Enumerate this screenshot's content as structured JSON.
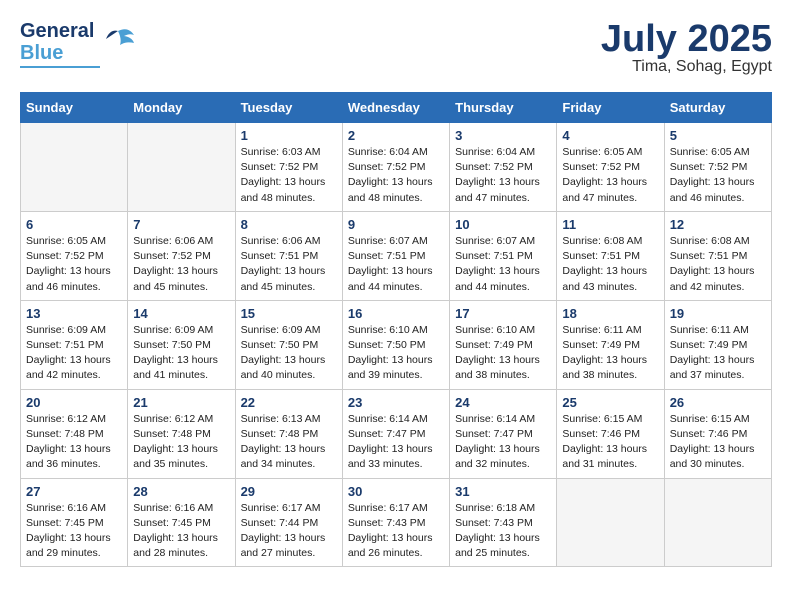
{
  "header": {
    "logo": {
      "line1": "General",
      "line2": "Blue"
    },
    "month": "July 2025",
    "location": "Tima, Sohag, Egypt"
  },
  "days_of_week": [
    "Sunday",
    "Monday",
    "Tuesday",
    "Wednesday",
    "Thursday",
    "Friday",
    "Saturday"
  ],
  "weeks": [
    [
      {
        "day": "",
        "empty": true
      },
      {
        "day": "",
        "empty": true
      },
      {
        "day": "1",
        "sunrise": "Sunrise: 6:03 AM",
        "sunset": "Sunset: 7:52 PM",
        "daylight": "Daylight: 13 hours and 48 minutes."
      },
      {
        "day": "2",
        "sunrise": "Sunrise: 6:04 AM",
        "sunset": "Sunset: 7:52 PM",
        "daylight": "Daylight: 13 hours and 48 minutes."
      },
      {
        "day": "3",
        "sunrise": "Sunrise: 6:04 AM",
        "sunset": "Sunset: 7:52 PM",
        "daylight": "Daylight: 13 hours and 47 minutes."
      },
      {
        "day": "4",
        "sunrise": "Sunrise: 6:05 AM",
        "sunset": "Sunset: 7:52 PM",
        "daylight": "Daylight: 13 hours and 47 minutes."
      },
      {
        "day": "5",
        "sunrise": "Sunrise: 6:05 AM",
        "sunset": "Sunset: 7:52 PM",
        "daylight": "Daylight: 13 hours and 46 minutes."
      }
    ],
    [
      {
        "day": "6",
        "sunrise": "Sunrise: 6:05 AM",
        "sunset": "Sunset: 7:52 PM",
        "daylight": "Daylight: 13 hours and 46 minutes."
      },
      {
        "day": "7",
        "sunrise": "Sunrise: 6:06 AM",
        "sunset": "Sunset: 7:52 PM",
        "daylight": "Daylight: 13 hours and 45 minutes."
      },
      {
        "day": "8",
        "sunrise": "Sunrise: 6:06 AM",
        "sunset": "Sunset: 7:51 PM",
        "daylight": "Daylight: 13 hours and 45 minutes."
      },
      {
        "day": "9",
        "sunrise": "Sunrise: 6:07 AM",
        "sunset": "Sunset: 7:51 PM",
        "daylight": "Daylight: 13 hours and 44 minutes."
      },
      {
        "day": "10",
        "sunrise": "Sunrise: 6:07 AM",
        "sunset": "Sunset: 7:51 PM",
        "daylight": "Daylight: 13 hours and 44 minutes."
      },
      {
        "day": "11",
        "sunrise": "Sunrise: 6:08 AM",
        "sunset": "Sunset: 7:51 PM",
        "daylight": "Daylight: 13 hours and 43 minutes."
      },
      {
        "day": "12",
        "sunrise": "Sunrise: 6:08 AM",
        "sunset": "Sunset: 7:51 PM",
        "daylight": "Daylight: 13 hours and 42 minutes."
      }
    ],
    [
      {
        "day": "13",
        "sunrise": "Sunrise: 6:09 AM",
        "sunset": "Sunset: 7:51 PM",
        "daylight": "Daylight: 13 hours and 42 minutes."
      },
      {
        "day": "14",
        "sunrise": "Sunrise: 6:09 AM",
        "sunset": "Sunset: 7:50 PM",
        "daylight": "Daylight: 13 hours and 41 minutes."
      },
      {
        "day": "15",
        "sunrise": "Sunrise: 6:09 AM",
        "sunset": "Sunset: 7:50 PM",
        "daylight": "Daylight: 13 hours and 40 minutes."
      },
      {
        "day": "16",
        "sunrise": "Sunrise: 6:10 AM",
        "sunset": "Sunset: 7:50 PM",
        "daylight": "Daylight: 13 hours and 39 minutes."
      },
      {
        "day": "17",
        "sunrise": "Sunrise: 6:10 AM",
        "sunset": "Sunset: 7:49 PM",
        "daylight": "Daylight: 13 hours and 38 minutes."
      },
      {
        "day": "18",
        "sunrise": "Sunrise: 6:11 AM",
        "sunset": "Sunset: 7:49 PM",
        "daylight": "Daylight: 13 hours and 38 minutes."
      },
      {
        "day": "19",
        "sunrise": "Sunrise: 6:11 AM",
        "sunset": "Sunset: 7:49 PM",
        "daylight": "Daylight: 13 hours and 37 minutes."
      }
    ],
    [
      {
        "day": "20",
        "sunrise": "Sunrise: 6:12 AM",
        "sunset": "Sunset: 7:48 PM",
        "daylight": "Daylight: 13 hours and 36 minutes."
      },
      {
        "day": "21",
        "sunrise": "Sunrise: 6:12 AM",
        "sunset": "Sunset: 7:48 PM",
        "daylight": "Daylight: 13 hours and 35 minutes."
      },
      {
        "day": "22",
        "sunrise": "Sunrise: 6:13 AM",
        "sunset": "Sunset: 7:48 PM",
        "daylight": "Daylight: 13 hours and 34 minutes."
      },
      {
        "day": "23",
        "sunrise": "Sunrise: 6:14 AM",
        "sunset": "Sunset: 7:47 PM",
        "daylight": "Daylight: 13 hours and 33 minutes."
      },
      {
        "day": "24",
        "sunrise": "Sunrise: 6:14 AM",
        "sunset": "Sunset: 7:47 PM",
        "daylight": "Daylight: 13 hours and 32 minutes."
      },
      {
        "day": "25",
        "sunrise": "Sunrise: 6:15 AM",
        "sunset": "Sunset: 7:46 PM",
        "daylight": "Daylight: 13 hours and 31 minutes."
      },
      {
        "day": "26",
        "sunrise": "Sunrise: 6:15 AM",
        "sunset": "Sunset: 7:46 PM",
        "daylight": "Daylight: 13 hours and 30 minutes."
      }
    ],
    [
      {
        "day": "27",
        "sunrise": "Sunrise: 6:16 AM",
        "sunset": "Sunset: 7:45 PM",
        "daylight": "Daylight: 13 hours and 29 minutes."
      },
      {
        "day": "28",
        "sunrise": "Sunrise: 6:16 AM",
        "sunset": "Sunset: 7:45 PM",
        "daylight": "Daylight: 13 hours and 28 minutes."
      },
      {
        "day": "29",
        "sunrise": "Sunrise: 6:17 AM",
        "sunset": "Sunset: 7:44 PM",
        "daylight": "Daylight: 13 hours and 27 minutes."
      },
      {
        "day": "30",
        "sunrise": "Sunrise: 6:17 AM",
        "sunset": "Sunset: 7:43 PM",
        "daylight": "Daylight: 13 hours and 26 minutes."
      },
      {
        "day": "31",
        "sunrise": "Sunrise: 6:18 AM",
        "sunset": "Sunset: 7:43 PM",
        "daylight": "Daylight: 13 hours and 25 minutes."
      },
      {
        "day": "",
        "empty": true
      },
      {
        "day": "",
        "empty": true
      }
    ]
  ]
}
